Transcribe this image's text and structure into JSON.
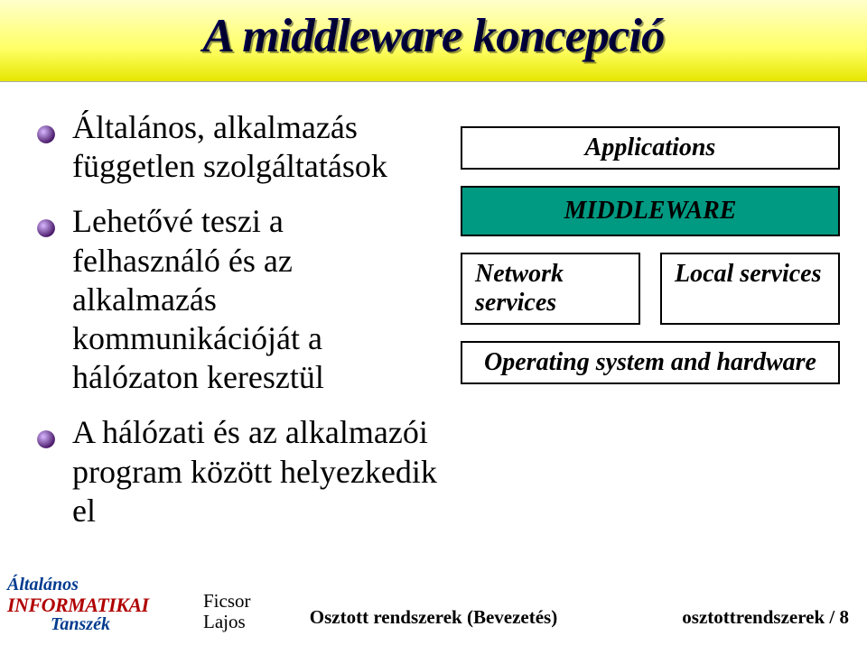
{
  "title": "A middleware koncepció",
  "bullets": [
    "Általános, alkalmazás független szolgáltatások",
    "Lehetővé teszi a felhasználó és az alkalmazás kommunikációját a hálózaton keresztül",
    "A hálózati és az alkalmazói program között helyezkedik el"
  ],
  "diagram": {
    "app": "Applications",
    "mw": "MIDDLEWARE",
    "net": "Network services",
    "local": "Local services",
    "os": "Operating system and hardware"
  },
  "footer": {
    "logo": {
      "l1": "Általános",
      "l2": "INFORMATIKAI",
      "l3": "Tanszék"
    },
    "author_l1": "Ficsor",
    "author_l2": "Lajos",
    "center": "Osztott rendszerek (Bevezetés)",
    "right_prefix": "osztottrendszerek",
    "right_sep": " / ",
    "right_page": "8"
  },
  "colors": {
    "mw_bg": "#009a82",
    "title_color": "#00004f"
  }
}
